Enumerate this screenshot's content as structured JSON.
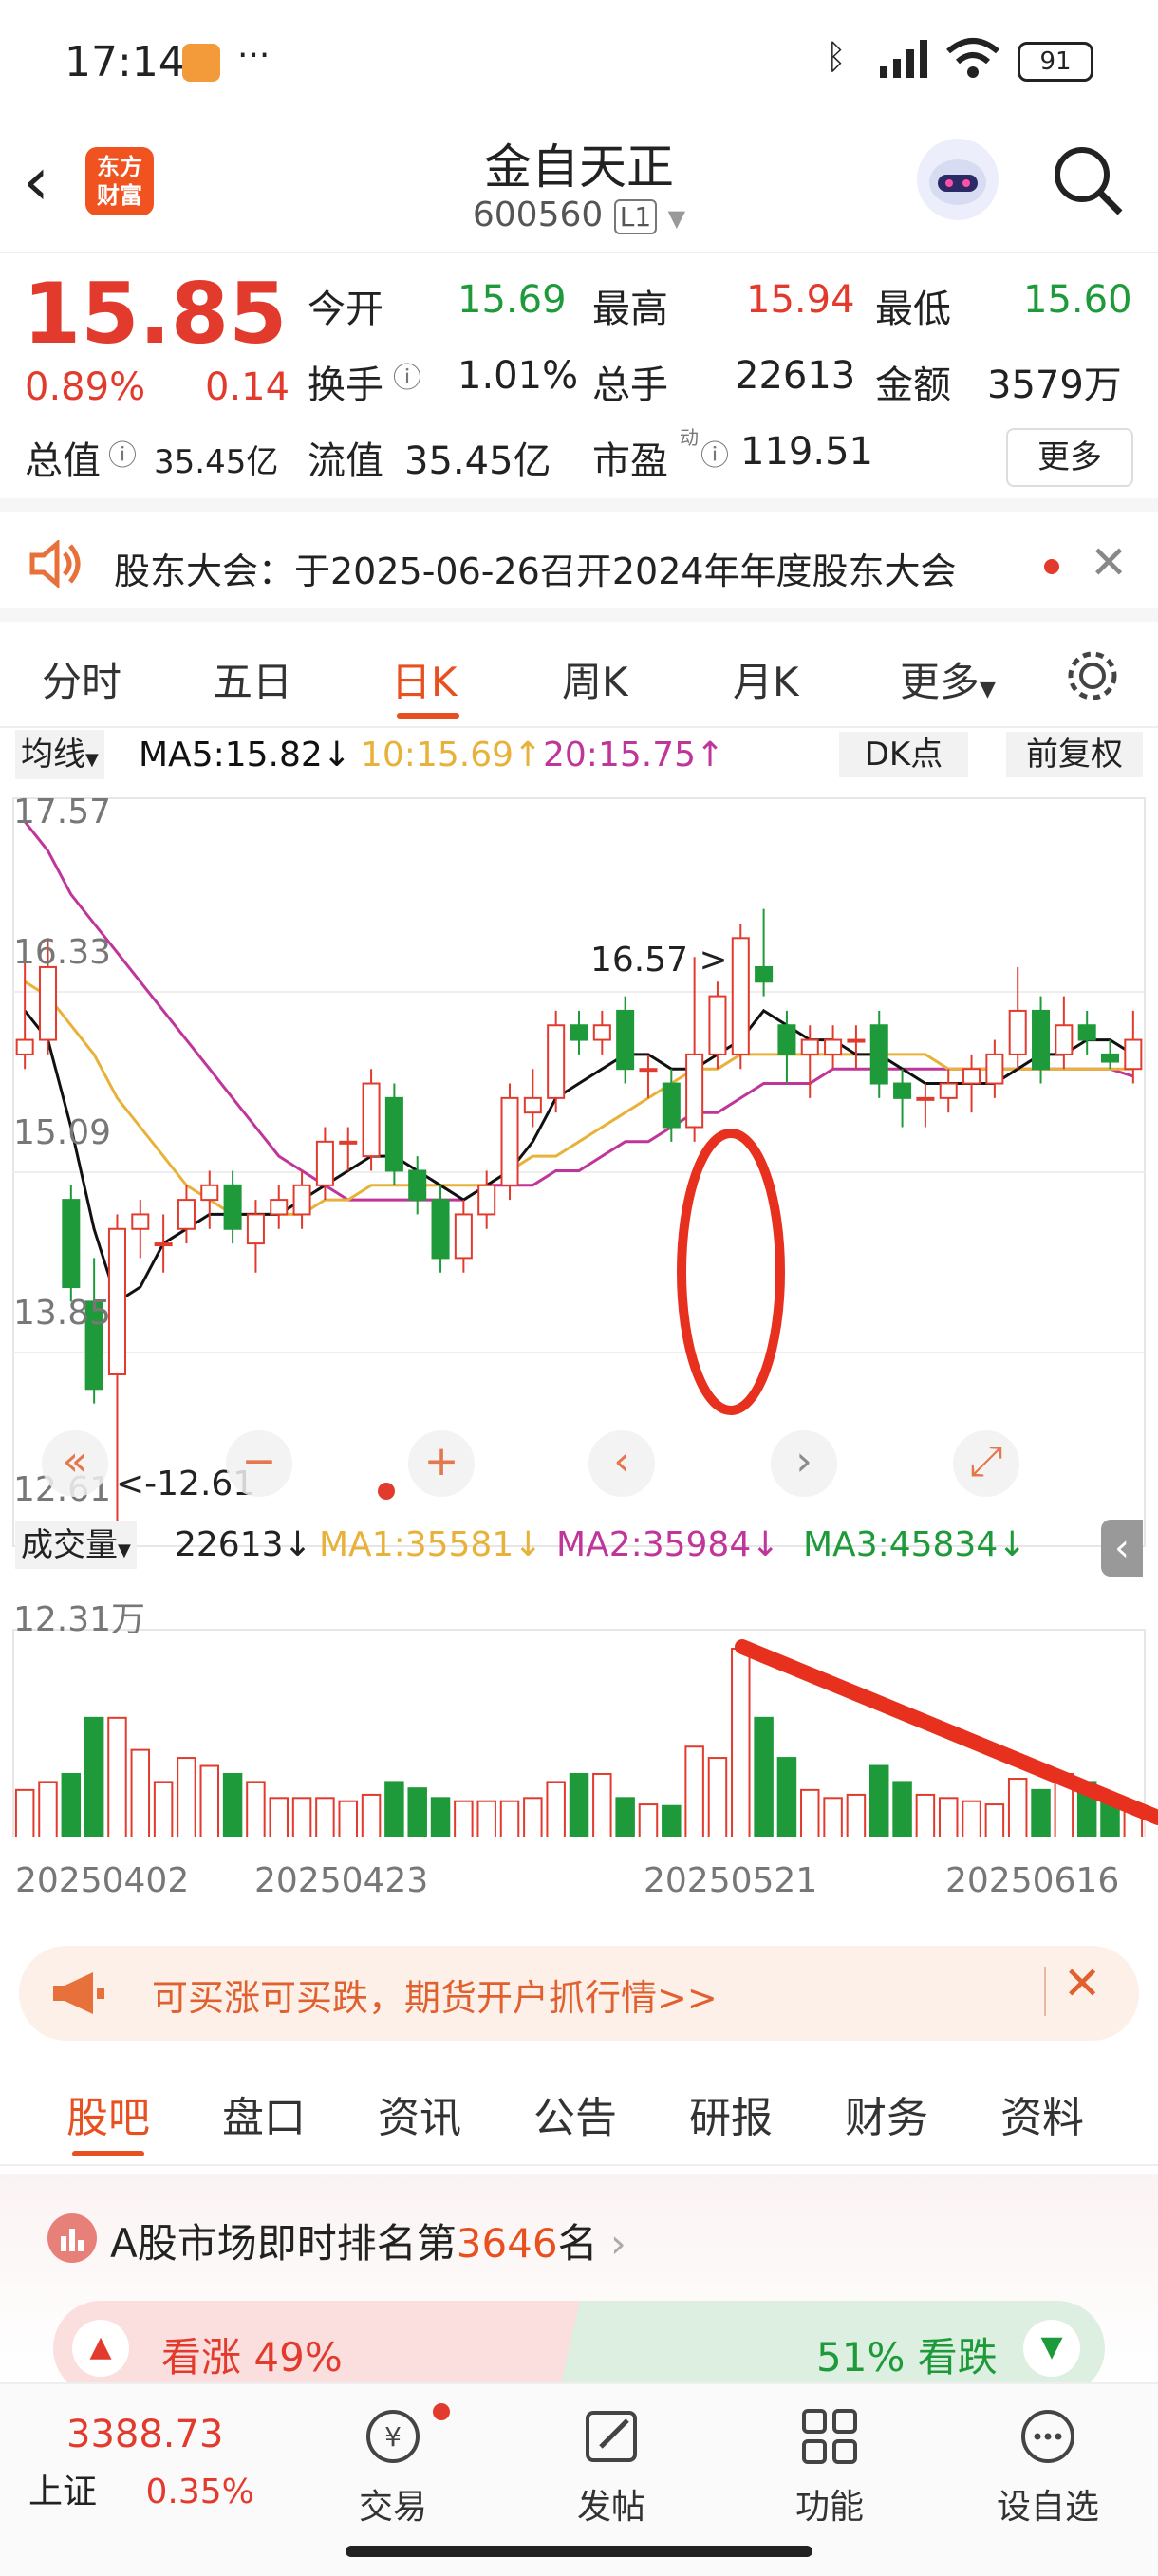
{
  "status_bar": {
    "time": "17:14",
    "dots": "···",
    "battery": "91"
  },
  "header": {
    "logo_line1": "东方",
    "logo_line2": "财富",
    "stock_name": "金自天正",
    "stock_code": "600560",
    "level": "L1"
  },
  "quote": {
    "price": "15.85",
    "change_pct": "0.89%",
    "change": "0.14",
    "open_label": "今开",
    "open": "15.69",
    "high_label": "最高",
    "high": "15.94",
    "low_label": "最低",
    "low": "15.60",
    "turnover_label": "换手",
    "turnover": "1.01%",
    "volume_label": "总手",
    "volume": "22613",
    "amount_label": "金额",
    "amount": "3579万",
    "mktcap_label": "总值",
    "mktcap": "35.45亿",
    "float_label": "流值",
    "float": "35.45亿",
    "pe_label": "市盈",
    "pe_sup": "动",
    "pe": "119.51",
    "more": "更多"
  },
  "notice": {
    "text": "股东大会：于2025-06-26召开2024年年度股东大会"
  },
  "chart_tabs": [
    "分时",
    "五日",
    "日K",
    "周K",
    "月K",
    "更多"
  ],
  "ma_bar": {
    "selector": "均线",
    "ma5": "MA5:15.82",
    "ma10": "10:15.69",
    "ma20": "20:15.75",
    "dk": "DK点",
    "fq": "前复权"
  },
  "chart_data": {
    "type": "candlestick",
    "y_ticks": [
      "17.57",
      "16.33",
      "15.09",
      "13.85",
      "12.61"
    ],
    "ylim": [
      12.61,
      17.57
    ],
    "annotations": [
      "16.57",
      "<-12.61"
    ],
    "volume_bar": {
      "selector": "成交量",
      "vol": "22613",
      "ma1": "MA1:35581",
      "ma2": "MA2:35984",
      "ma3": "MA3:45834",
      "max": "12.31万"
    },
    "x_dates": [
      "20250402",
      "20250423",
      "20250521",
      "20250616"
    ],
    "candles": [
      [
        15.9,
        16.0,
        16.6,
        15.8
      ],
      [
        16.0,
        16.5,
        16.7,
        15.9
      ],
      [
        14.9,
        14.3,
        15.0,
        14.2
      ],
      [
        14.2,
        13.6,
        14.5,
        13.5
      ],
      [
        13.7,
        14.7,
        14.8,
        12.61
      ],
      [
        14.7,
        14.8,
        14.9,
        14.5
      ],
      [
        14.6,
        14.6,
        14.8,
        14.4
      ],
      [
        14.7,
        14.9,
        15.0,
        14.6
      ],
      [
        14.9,
        15.0,
        15.1,
        14.7
      ],
      [
        15.0,
        14.7,
        15.1,
        14.6
      ],
      [
        14.6,
        14.8,
        14.9,
        14.4
      ],
      [
        14.8,
        14.9,
        15.0,
        14.7
      ],
      [
        14.8,
        15.0,
        15.1,
        14.7
      ],
      [
        15.0,
        15.3,
        15.4,
        14.9
      ],
      [
        15.3,
        15.3,
        15.4,
        15.1
      ],
      [
        15.2,
        15.7,
        15.8,
        15.1
      ],
      [
        15.6,
        15.1,
        15.7,
        15.0
      ],
      [
        15.1,
        14.9,
        15.2,
        14.8
      ],
      [
        14.9,
        14.5,
        15.0,
        14.4
      ],
      [
        14.5,
        14.8,
        14.9,
        14.4
      ],
      [
        14.8,
        15.0,
        15.1,
        14.7
      ],
      [
        15.0,
        15.6,
        15.7,
        14.9
      ],
      [
        15.5,
        15.6,
        15.8,
        15.4
      ],
      [
        15.6,
        16.1,
        16.2,
        15.5
      ],
      [
        16.1,
        16.0,
        16.2,
        15.9
      ],
      [
        16.0,
        16.1,
        16.2,
        15.9
      ],
      [
        16.2,
        15.8,
        16.3,
        15.7
      ],
      [
        15.8,
        15.8,
        15.9,
        15.6
      ],
      [
        15.7,
        15.4,
        15.8,
        15.3
      ],
      [
        15.4,
        15.9,
        16.57,
        15.3
      ],
      [
        15.9,
        16.3,
        16.4,
        15.8
      ],
      [
        15.9,
        16.7,
        16.8,
        15.8
      ],
      [
        16.5,
        16.4,
        16.9,
        16.3
      ],
      [
        16.1,
        15.9,
        16.2,
        15.7
      ],
      [
        15.9,
        16.0,
        16.1,
        15.6
      ],
      [
        15.9,
        16.0,
        16.1,
        15.8
      ],
      [
        16.0,
        16.0,
        16.1,
        15.8
      ],
      [
        16.1,
        15.7,
        16.2,
        15.6
      ],
      [
        15.7,
        15.6,
        15.8,
        15.4
      ],
      [
        15.6,
        15.6,
        15.7,
        15.4
      ],
      [
        15.6,
        15.7,
        15.8,
        15.5
      ],
      [
        15.7,
        15.8,
        15.9,
        15.5
      ],
      [
        15.7,
        15.9,
        16.0,
        15.6
      ],
      [
        15.9,
        16.2,
        16.5,
        15.8
      ],
      [
        16.2,
        15.8,
        16.3,
        15.7
      ],
      [
        15.9,
        16.1,
        16.3,
        15.8
      ],
      [
        16.1,
        16.0,
        16.2,
        15.9
      ],
      [
        15.9,
        15.85,
        16.0,
        15.8
      ],
      [
        15.8,
        16.0,
        16.2,
        15.7
      ]
    ],
    "ma5": [
      16.2,
      16.0,
      15.4,
      14.7,
      14.2,
      14.3,
      14.6,
      14.7,
      14.8,
      14.8,
      14.8,
      14.8,
      14.9,
      15.0,
      15.1,
      15.2,
      15.2,
      15.1,
      15.0,
      14.9,
      15.0,
      15.1,
      15.3,
      15.6,
      15.7,
      15.8,
      15.9,
      15.9,
      15.8,
      15.8,
      15.9,
      16.0,
      16.2,
      16.1,
      16.0,
      16.0,
      15.9,
      15.9,
      15.8,
      15.7,
      15.7,
      15.7,
      15.7,
      15.8,
      15.9,
      15.9,
      16.0,
      16.0,
      15.9
    ],
    "ma10": [
      16.4,
      16.3,
      16.1,
      15.9,
      15.6,
      15.4,
      15.2,
      15.0,
      14.9,
      14.8,
      14.8,
      14.8,
      14.8,
      14.9,
      14.9,
      15.0,
      15.0,
      15.0,
      15.0,
      15.0,
      15.0,
      15.1,
      15.2,
      15.2,
      15.3,
      15.4,
      15.5,
      15.6,
      15.7,
      15.8,
      15.8,
      15.9,
      15.9,
      15.9,
      15.9,
      15.9,
      15.9,
      15.9,
      15.9,
      15.9,
      15.8,
      15.8,
      15.8,
      15.8,
      15.8,
      15.8,
      15.8,
      15.8,
      15.8
    ],
    "ma20": [
      17.5,
      17.3,
      17.0,
      16.8,
      16.6,
      16.4,
      16.2,
      16.0,
      15.8,
      15.6,
      15.4,
      15.2,
      15.1,
      15.0,
      14.9,
      14.9,
      14.9,
      14.9,
      14.9,
      14.9,
      15.0,
      15.0,
      15.0,
      15.1,
      15.1,
      15.2,
      15.3,
      15.3,
      15.4,
      15.5,
      15.5,
      15.6,
      15.7,
      15.7,
      15.7,
      15.8,
      15.8,
      15.8,
      15.8,
      15.8,
      15.8,
      15.8,
      15.8,
      15.8,
      15.8,
      15.8,
      15.8,
      15.8,
      15.75
    ],
    "volumes": [
      3.5,
      4.0,
      4.5,
      8.0,
      8.0,
      6.0,
      4.0,
      5.5,
      5.0,
      4.5,
      4.0,
      3.0,
      3.0,
      3.0,
      2.8,
      3.2,
      4.0,
      3.6,
      3.0,
      2.8,
      2.8,
      2.8,
      3.0,
      4.0,
      4.5,
      4.5,
      3.0,
      2.6,
      2.5,
      6.2,
      5.5,
      12.31,
      8.0,
      5.5,
      3.5,
      3.0,
      3.2,
      5.0,
      4.0,
      3.2,
      3.0,
      2.8,
      2.6,
      4.2,
      3.5,
      4.5,
      4.0,
      3.0,
      2.2
    ],
    "volume_max": 12.31
  },
  "banner": {
    "text": "可买涨可买跌，期货开户抓行情>>"
  },
  "bottom_tabs": [
    "股吧",
    "盘口",
    "资讯",
    "公告",
    "研报",
    "财务",
    "资料"
  ],
  "rank": {
    "prefix": "A股市场即时排名第",
    "num": "3646",
    "suffix": "名"
  },
  "vote": {
    "up_label": "看涨",
    "up_pct": "49%",
    "down_pct": "51%",
    "down_label": "看跌"
  },
  "nav": {
    "index_val": "3388.73",
    "index_name": "上证",
    "index_chg": "0.35%",
    "items": [
      "交易",
      "发帖",
      "功能",
      "设自选"
    ]
  },
  "colors": {
    "red": "#e23b2e",
    "green": "#1f9a3a",
    "ma5": "#111111",
    "ma10": "#e8b23a",
    "ma20": "#c0359a"
  }
}
